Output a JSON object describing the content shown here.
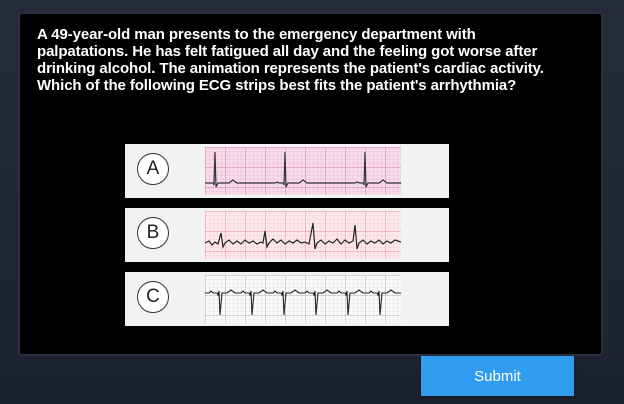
{
  "question": {
    "text": "A 49-year-old man presents to the emergency department with palpatations. He has felt fatigued all day and the feeling got worse after drinking alcohol. The animation represents the patient's cardiac activity. Which of the following ECG strips best fits the patient's arrhythmia?"
  },
  "options": [
    {
      "letter": "A",
      "strip": "ecg-strip-pink-grid-widely-spaced-beats"
    },
    {
      "letter": "B",
      "strip": "ecg-strip-pink-grid-irregular-fibrillatory"
    },
    {
      "letter": "C",
      "strip": "ecg-strip-gray-grid-regular-beats"
    }
  ],
  "submit": {
    "label": "Submit"
  },
  "colors": {
    "panel": "#000000",
    "background": "#1e2431",
    "submit": "#2f9cf0",
    "option_bg": "#f2f2f2"
  }
}
